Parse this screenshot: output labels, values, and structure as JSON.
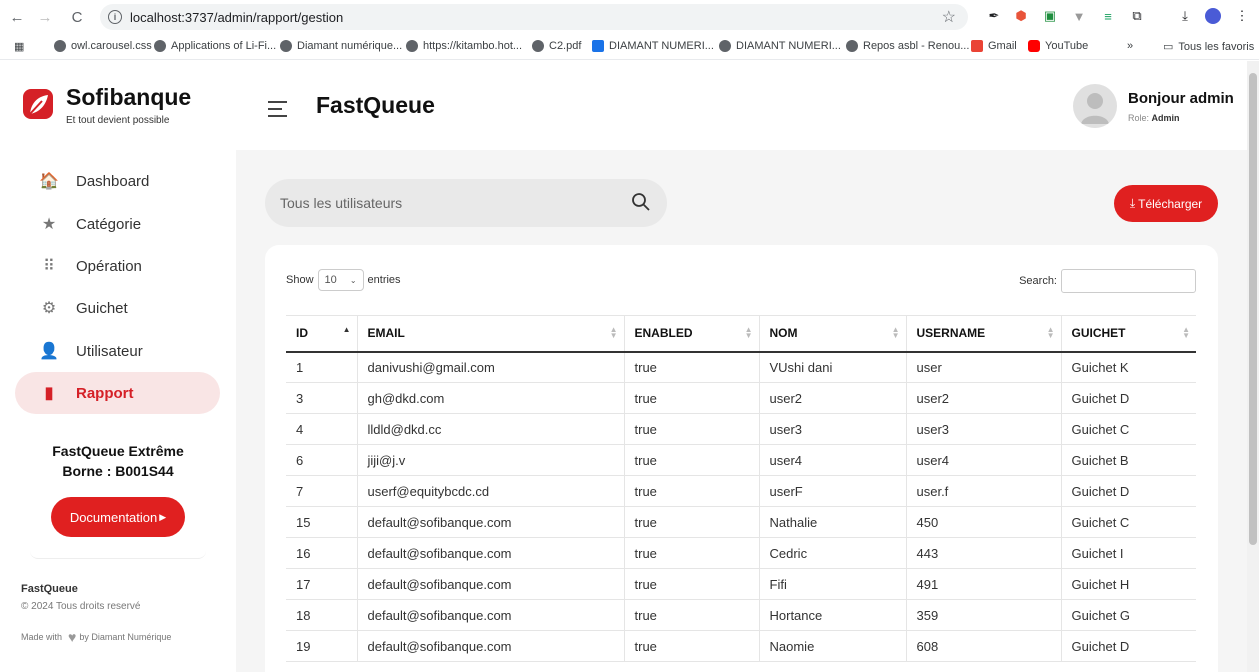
{
  "browser": {
    "url": "localhost:3737/admin/rapport/gestion",
    "bookmarks": [
      {
        "label": "owl.carousel.css",
        "color": "#5f6368"
      },
      {
        "label": "Applications of Li-Fi...",
        "color": "#5f6368"
      },
      {
        "label": "Diamant numérique...",
        "color": "#5f6368"
      },
      {
        "label": "https://kitambo.hot...",
        "color": "#5f6368"
      },
      {
        "label": "C2.pdf",
        "color": "#5f6368"
      },
      {
        "label": "DIAMANT NUMERI...",
        "color": "#1a73e8"
      },
      {
        "label": "DIAMANT NUMERI...",
        "color": "#5f6368"
      },
      {
        "label": "Repos asbl - Renou...",
        "color": "#5f6368"
      },
      {
        "label": "Gmail",
        "color": "#ea4335"
      },
      {
        "label": "YouTube",
        "color": "#ff0000"
      }
    ],
    "more": "»",
    "all_bookmarks": "Tous les favoris"
  },
  "sidebar": {
    "brand": "Sofibanque",
    "tagline": "Et tout devient possible",
    "items": [
      {
        "label": "Dashboard",
        "icon": "home-icon",
        "glyph": "🏠"
      },
      {
        "label": "Catégorie",
        "icon": "star-icon",
        "glyph": "★"
      },
      {
        "label": "Opération",
        "icon": "grid-icon",
        "glyph": "⠿"
      },
      {
        "label": "Guichet",
        "icon": "gear-icon",
        "glyph": "⚙"
      },
      {
        "label": "Utilisateur",
        "icon": "user-icon",
        "glyph": "👤"
      },
      {
        "label": "Rapport",
        "icon": "file-icon",
        "glyph": "▮"
      }
    ],
    "promo_line1": "FastQueue Extrême",
    "promo_line2": "Borne : B001S44",
    "doc_button": "Documentation",
    "footer_brand": "FastQueue",
    "footer_copy": "© 2024 Tous droits reservé",
    "footer_made_prefix": "Made with",
    "footer_made_suffix": "by Diamant Numérique"
  },
  "header": {
    "title": "FastQueue",
    "greeting": "Bonjour admin",
    "role_label": "Role:",
    "role_value": "Admin"
  },
  "toolbar": {
    "search_placeholder": "Tous les utilisateurs",
    "download_label": "Télécharger"
  },
  "table": {
    "show_label": "Show",
    "entries_value": "10",
    "entries_label": "entries",
    "search_label": "Search:",
    "columns": [
      "ID",
      "EMAIL",
      "ENABLED",
      "NOM",
      "USERNAME",
      "GUICHET"
    ],
    "rows": [
      [
        "1",
        "danivushi@gmail.com",
        "true",
        "VUshi dani",
        "user",
        "Guichet K"
      ],
      [
        "3",
        "gh@dkd.com",
        "true",
        "user2",
        "user2",
        "Guichet D"
      ],
      [
        "4",
        "lldld@dkd.cc",
        "true",
        "user3",
        "user3",
        "Guichet C"
      ],
      [
        "6",
        "jiji@j.v",
        "true",
        "user4",
        "user4",
        "Guichet B"
      ],
      [
        "7",
        "userf@equitybcdc.cd",
        "true",
        "userF",
        "user.f",
        "Guichet D"
      ],
      [
        "15",
        "default@sofibanque.com",
        "true",
        "Nathalie",
        "450",
        "Guichet C"
      ],
      [
        "16",
        "default@sofibanque.com",
        "true",
        "Cedric",
        "443",
        "Guichet I"
      ],
      [
        "17",
        "default@sofibanque.com",
        "true",
        "Fifi",
        "491",
        "Guichet H"
      ],
      [
        "18",
        "default@sofibanque.com",
        "true",
        "Hortance",
        "359",
        "Guichet G"
      ],
      [
        "19",
        "default@sofibanque.com",
        "true",
        "Naomie",
        "608",
        "Guichet D"
      ]
    ]
  },
  "colors": {
    "accent": "#e02020",
    "active_bg": "#f9e5e5"
  }
}
